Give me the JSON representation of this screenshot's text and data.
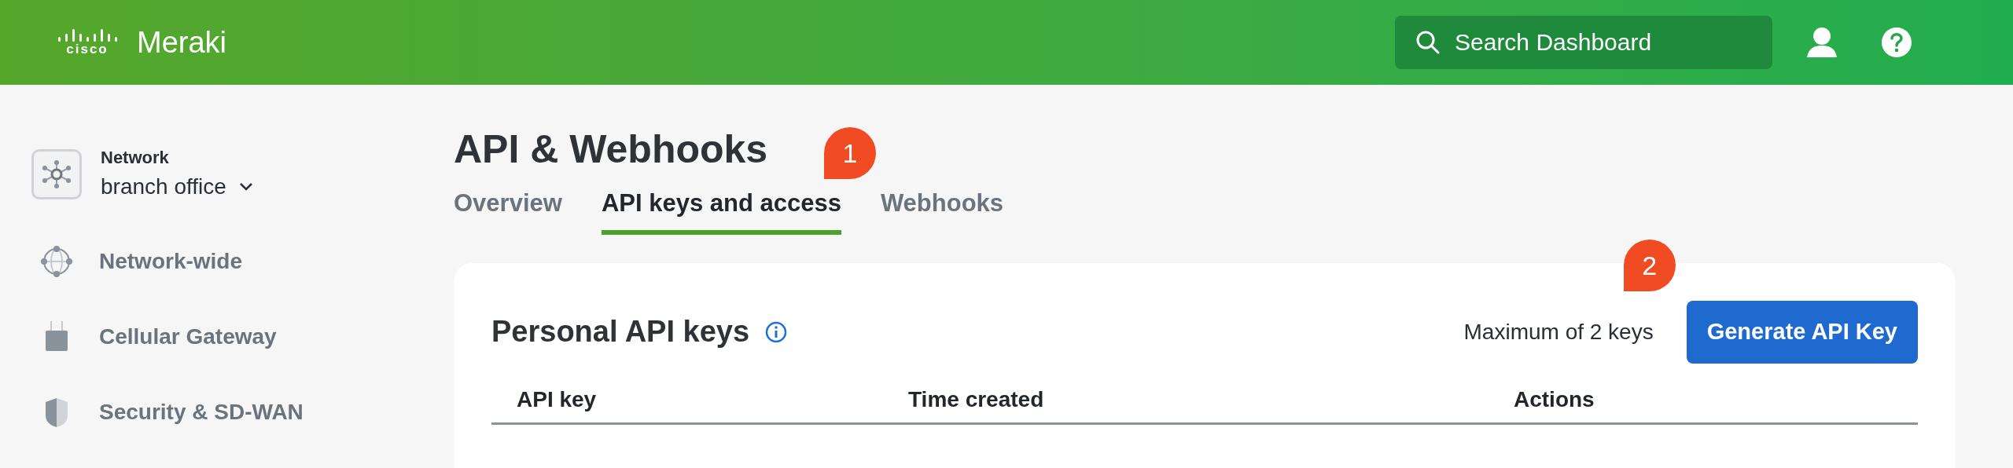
{
  "header": {
    "logo_mark": "cisco",
    "logo_text": "Meraki",
    "search": {
      "placeholder": "Search Dashboard"
    }
  },
  "sidebar": {
    "network": {
      "label": "Network",
      "value": "branch office"
    },
    "items": [
      {
        "kind": "globe",
        "label": "Network-wide"
      },
      {
        "kind": "gateway",
        "label": "Cellular Gateway"
      },
      {
        "kind": "shield",
        "label": "Security & SD-WAN"
      }
    ]
  },
  "page": {
    "title": "API & Webhooks",
    "tabs": [
      {
        "label": "Overview",
        "selected": false
      },
      {
        "label": "API keys and access",
        "selected": true,
        "callout": "1"
      },
      {
        "label": "Webhooks",
        "selected": false
      }
    ],
    "card": {
      "title": "Personal API keys",
      "limit": "Maximum of 2 keys",
      "button": "Generate API Key",
      "button_callout": "2",
      "columns": [
        "API key",
        "Time created",
        "Actions"
      ]
    }
  }
}
